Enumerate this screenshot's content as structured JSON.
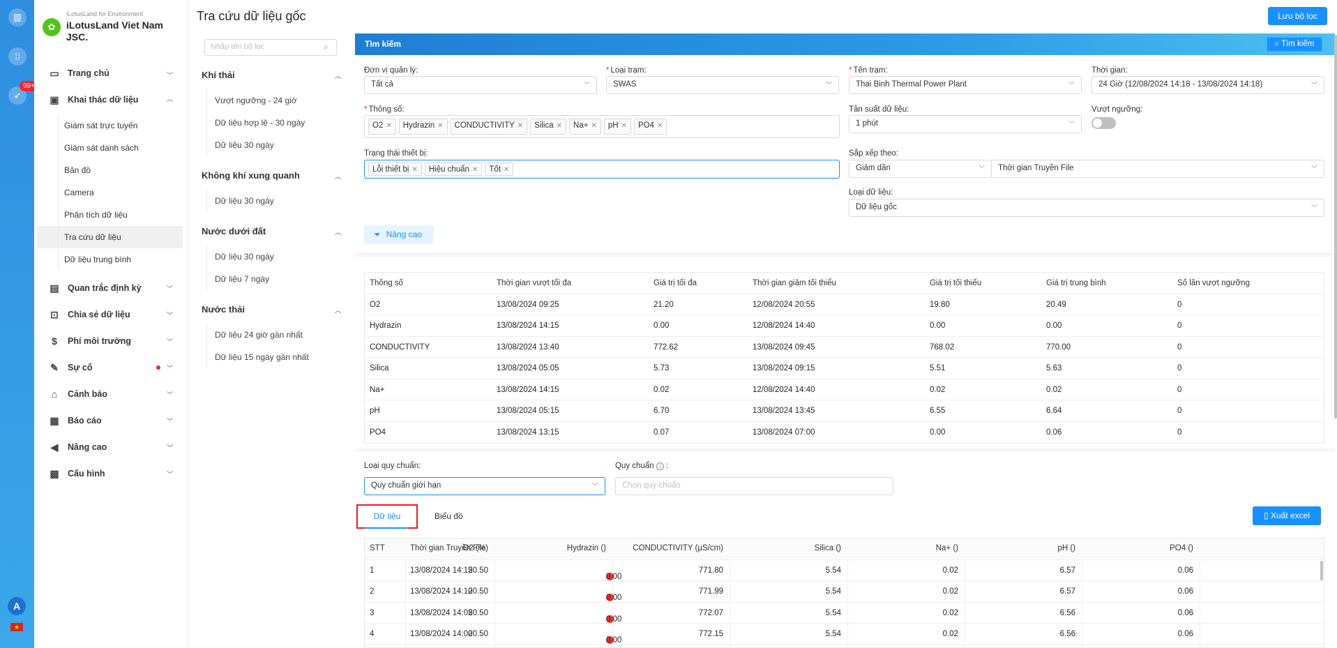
{
  "app": {
    "title": "Tra cứu dữ liệu gốc",
    "save_filter": "Lưu bộ lọc",
    "badge": "99+",
    "avatar": "A",
    "flag": "★"
  },
  "brand": {
    "sub": "iLotusLand for Environment",
    "name": "iLotusLand Viet Nam JSC."
  },
  "menu": [
    {
      "label": "Trang chủ",
      "icon": "home-icon"
    },
    {
      "label": "Khai thác dữ liệu",
      "icon": "monitor-icon"
    },
    {
      "label": "Quan trắc định kỳ",
      "icon": "calendar-icon"
    },
    {
      "label": "Chia sẻ dữ liệu",
      "icon": "share-icon"
    },
    {
      "label": "Phí môi trường",
      "icon": "dollar-icon"
    },
    {
      "label": "Sự cố",
      "icon": "edit-icon"
    },
    {
      "label": "Cảnh báo",
      "icon": "alarm-icon"
    },
    {
      "label": "Báo cáo",
      "icon": "report-icon"
    },
    {
      "label": "Nâng cao",
      "icon": "megaphone-icon"
    },
    {
      "label": "Cấu hình",
      "icon": "config-icon"
    }
  ],
  "submenu": [
    "Giám sát trực tuyến",
    "Giám sát danh sách",
    "Bản đồ",
    "Camera",
    "Phân tích dữ liệu",
    "Tra cứu dữ liệu",
    "Dữ liệu trung bình"
  ],
  "filters": {
    "search_placeholder": "Nhập tên bộ lọc",
    "groups": [
      {
        "title": "Khí thải",
        "items": [
          "Vượt ngưỡng - 24 giờ",
          "Dữ liệu hợp lệ - 30 ngày",
          "Dữ liệu 30 ngày"
        ]
      },
      {
        "title": "Không khí xung quanh",
        "items": [
          "Dữ liệu 30 ngày"
        ]
      },
      {
        "title": "Nước dưới đất",
        "items": [
          "Dữ liệu 30 ngày",
          "Dữ liệu 7 ngày"
        ]
      },
      {
        "title": "Nước thải",
        "items": [
          "Dữ liệu 24 giờ gần nhất",
          "Dữ liệu 15 ngày gần nhất"
        ]
      }
    ]
  },
  "search": {
    "title": "Tìm kiếm",
    "button": "Tìm kiếm",
    "don_vi_label": "Đơn vị quản lý:",
    "don_vi_value": "Tất cả",
    "loai_tram_label": "Loại trạm:",
    "loai_tram_value": "SWAS",
    "ten_tram_label": "Tên trạm:",
    "ten_tram_value": "Thai Binh Thermal Power Plant",
    "thoi_gian_label": "Thời gian:",
    "thoi_gian_value": "24 Giờ (12/08/2024 14:18 - 13/08/2024 14:18)",
    "thong_so_label": "Thông số:",
    "thong_so_tags": [
      "O2",
      "Hydrazin",
      "CONDUCTIVITY",
      "Silica",
      "Na+",
      "pH",
      "PO4"
    ],
    "tan_suat_label": "Tần suất dữ liệu:",
    "tan_suat_value": "1 phút",
    "vuot_nguong_label": "Vượt ngưỡng:",
    "trang_thai_label": "Trạng thái thiết bị:",
    "trang_thai_tags": [
      "Lỗi thiết bị",
      "Hiệu chuẩn",
      "Tốt"
    ],
    "sap_xep_label": "Sắp xếp theo:",
    "sap_xep_order": "Giảm dần",
    "sap_xep_field": "Thời gian Truyền File",
    "loai_du_lieu_label": "Loại dữ liệu:",
    "loai_du_lieu_value": "Dữ liệu gốc",
    "advanced": "Nâng cao"
  },
  "summary": {
    "headers": [
      "Thông số",
      "Thời gian vượt tối đa",
      "Giá trị tối đa",
      "Thời gian giảm tối thiểu",
      "Giá trị tối thiểu",
      "Giá trị trung bình",
      "Số lần vượt ngưỡng"
    ],
    "rows": [
      [
        "O2",
        "13/08/2024 09:25",
        "21.20",
        "12/08/2024 20:55",
        "19.80",
        "20.49",
        "0"
      ],
      [
        "Hydrazin",
        "13/08/2024 14:15",
        "0.00",
        "12/08/2024 14:40",
        "0.00",
        "0.00",
        "0"
      ],
      [
        "CONDUCTIVITY",
        "13/08/2024 13:40",
        "772.62",
        "13/08/2024 09:45",
        "768.02",
        "770.00",
        "0"
      ],
      [
        "Silica",
        "13/08/2024 05:05",
        "5.73",
        "13/08/2024 09:15",
        "5.51",
        "5.63",
        "0"
      ],
      [
        "Na+",
        "13/08/2024 14:15",
        "0.02",
        "12/08/2024 14:40",
        "0.02",
        "0.02",
        "0"
      ],
      [
        "pH",
        "13/08/2024 05:15",
        "6.70",
        "13/08/2024 13:45",
        "6.55",
        "6.64",
        "0"
      ],
      [
        "PO4",
        "13/08/2024 13:15",
        "0.07",
        "13/08/2024 07:00",
        "0.00",
        "0.06",
        "0"
      ]
    ]
  },
  "standard": {
    "type_label": "Loại quy chuẩn:",
    "type_value": "Quy chuẩn giới hạn",
    "qc_label": "Quy chuẩn",
    "qc_suffix": ":",
    "qc_placeholder": "Chọn quy chuẩn"
  },
  "tabs": {
    "data": "Dữ liệu",
    "chart": "Biểu đồ",
    "export": "Xuất excel"
  },
  "data_table": {
    "headers": [
      "STT",
      "Thời gian Truyền File",
      "O2 (%)",
      "Hydrazin ()",
      "CONDUCTIVITY (µS/cm)",
      "Silica ()",
      "Na+ ()",
      "pH ()",
      "PO4 ()"
    ],
    "rows": [
      [
        "1",
        "13/08/2024 14:15",
        "20.50",
        "0.00",
        "771.80",
        "5.54",
        "0.02",
        "6.57",
        "0.06"
      ],
      [
        "2",
        "13/08/2024 14:10",
        "20.50",
        "0.00",
        "771.99",
        "5.54",
        "0.02",
        "6.57",
        "0.06"
      ],
      [
        "3",
        "13/08/2024 14:05",
        "20.50",
        "0.00",
        "772.07",
        "5.54",
        "0.02",
        "6.56",
        "0.06"
      ],
      [
        "4",
        "13/08/2024 14:00",
        "20.50",
        "0.00",
        "772.15",
        "5.54",
        "0.02",
        "6.56",
        "0.06"
      ]
    ]
  }
}
